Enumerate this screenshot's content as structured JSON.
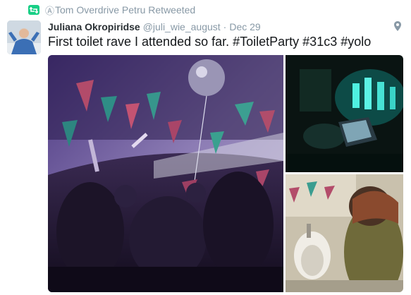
{
  "retweet": {
    "icon": "retweet-icon",
    "prefix": "Ⓐ",
    "text": "Tom Overdrive Petru Retweeted"
  },
  "tweet": {
    "avatar_icon": "user-avatar",
    "fullname": "Juliana Okropiridse",
    "username": "@juli_wie_august",
    "separator": "·",
    "time": "Dec 29",
    "geo_icon": "location-pin-icon",
    "text": "First toilet rave I attended so far. #ToiletParty #31c3 #yolo"
  },
  "colors": {
    "retweet_green": "#19cf86",
    "meta_gray": "#8899a6",
    "name_dark": "#292f33"
  },
  "media": [
    {
      "name": "party-crowd-photo"
    },
    {
      "name": "dj-laptop-photo"
    },
    {
      "name": "urinal-photo"
    }
  ]
}
